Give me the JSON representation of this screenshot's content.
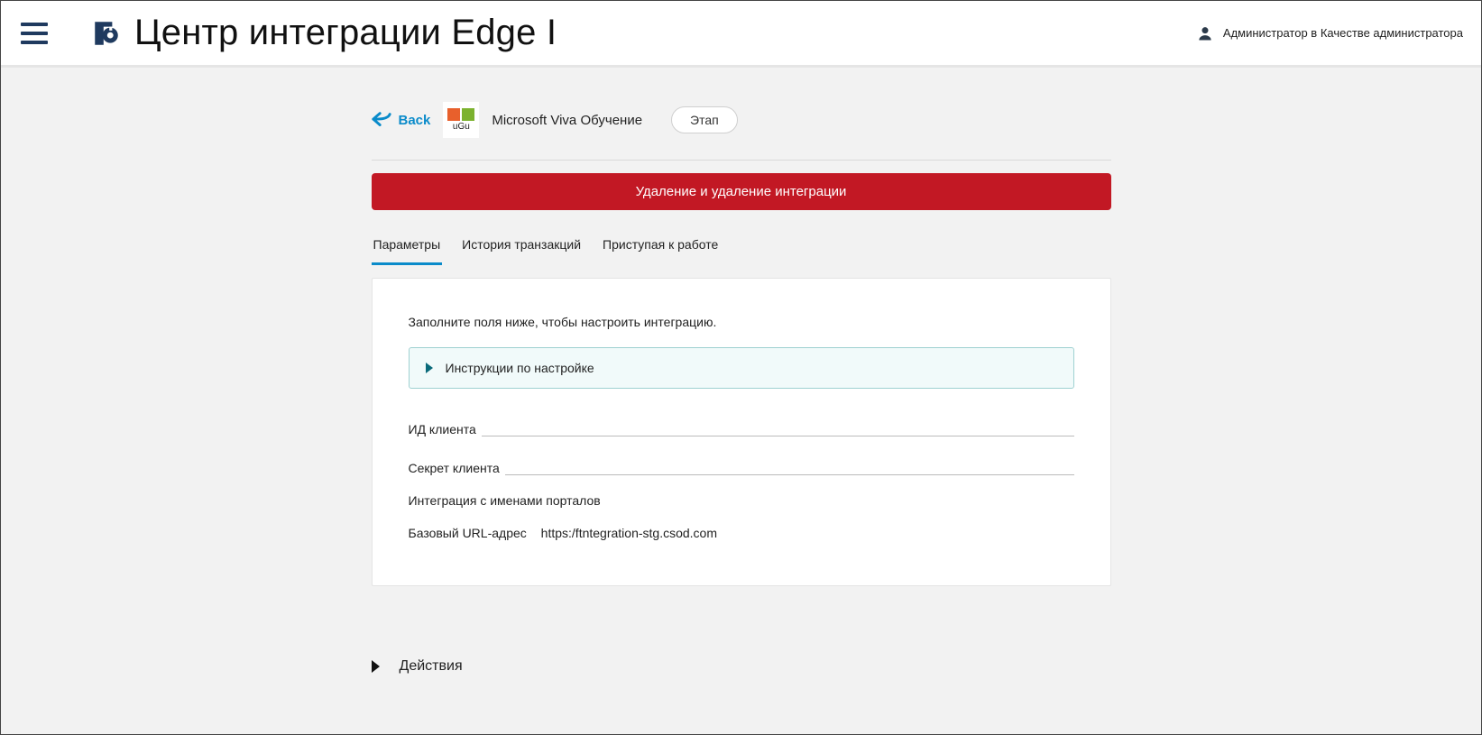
{
  "header": {
    "title": "Центр интеграции Edge I",
    "user_label": "Администратор в Качестве администратора"
  },
  "head": {
    "back_label": "Back",
    "app_sub": "uGu",
    "app_title": "Microsoft Viva Обучение",
    "stage_label": "Этап"
  },
  "danger_label": "Удаление и удаление интеграции",
  "tabs": [
    {
      "label": "Параметры",
      "active": true
    },
    {
      "label": "История транзакций",
      "active": false
    },
    {
      "label": "Приступая к работе",
      "active": false
    }
  ],
  "panel": {
    "intro": "Заполните поля ниже, чтобы настроить интеграцию.",
    "accordion_label": "Инструкции по настройке",
    "fields": {
      "client_id_label": "ИД клиента",
      "client_id_value": "",
      "client_secret_label": "Секрет клиента",
      "client_secret_value": "",
      "portal_label": "Интеграция с именами порталов",
      "base_url_label": "Базовый URL-адрес",
      "base_url_value": "https:/ftntegration-stg.csod.com"
    }
  },
  "actions_label": "Действия"
}
